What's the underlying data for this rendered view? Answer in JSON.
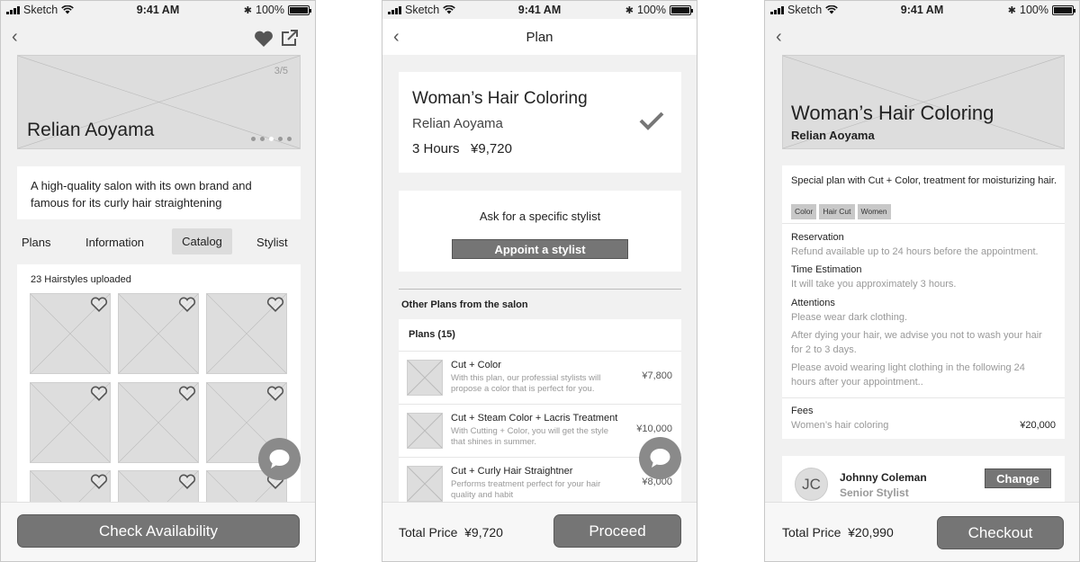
{
  "status_bar": {
    "carrier": "Sketch",
    "time": "9:41 AM",
    "battery": "100%"
  },
  "screen1": {
    "hero_counter": "3/5",
    "salon_name": "Relian Aoyama",
    "description": "A high-quality salon with its own brand and famous for its curly hair straightening",
    "tabs": [
      "Plans",
      "Information",
      "Catalog",
      "Stylist"
    ],
    "active_tab": "Catalog",
    "catalog_count": "23 Hairstyles uploaded",
    "cta": "Check Availability"
  },
  "screen2": {
    "title": "Plan",
    "plan_name": "Woman’s Hair Coloring",
    "salon_name": "Relian Aoyama",
    "duration": "3 Hours",
    "price": "¥9,720",
    "stylist_prompt": "Ask for a specific stylist",
    "appoint_label": "Appoint a stylist",
    "other_plans_header": "Other Plans from the salon",
    "plans_count": "Plans (15)",
    "plans": [
      {
        "name": "Cut + Color",
        "desc": "With this plan, our professial stylists will propose a color that is perfect for you.",
        "price": "¥7,800"
      },
      {
        "name": "Cut + Steam Color + Lacris Treatment",
        "desc": "With Cutting + Color, you will get the style that shines in summer.",
        "price": "¥10,000"
      },
      {
        "name": "Cut + Curly Hair Straightner",
        "desc": "Performs treatment perfect for your hair quality and habit",
        "price": "¥8,000"
      }
    ],
    "total_label": "Total Price",
    "total_price": "¥9,720",
    "proceed": "Proceed"
  },
  "screen3": {
    "plan_name": "Woman’s Hair Coloring",
    "salon_name": "Relian Aoyama",
    "summary": "Special plan with Cut + Color, treatment for moisturizing hair.",
    "tags": [
      "Color",
      "Hair Cut",
      "Women"
    ],
    "reservation_label": "Reservation",
    "reservation_text": "Refund available up to 24 hours before the appointment.",
    "time_label": "Time Estimation",
    "time_text": "It will take you approximately 3 hours.",
    "attentions_label": "Attentions",
    "attention_1": "Please wear dark clothing.",
    "attention_2": "After dying your hair, we advise you not to wash your hair for 2 to 3 days.",
    "attention_3": "Please avoid wearing light clothing in the following 24 hours after your appointment..",
    "fees_label": "Fees",
    "fees_item": "Women’s hair coloring",
    "fees_price": "¥20,000",
    "stylist_initials": "JC",
    "stylist_name": "Johnny Coleman",
    "stylist_role": "Senior Stylist",
    "change_label": "Change",
    "total_label": "Total Price",
    "total_price": "¥20,990",
    "checkout": "Checkout"
  }
}
